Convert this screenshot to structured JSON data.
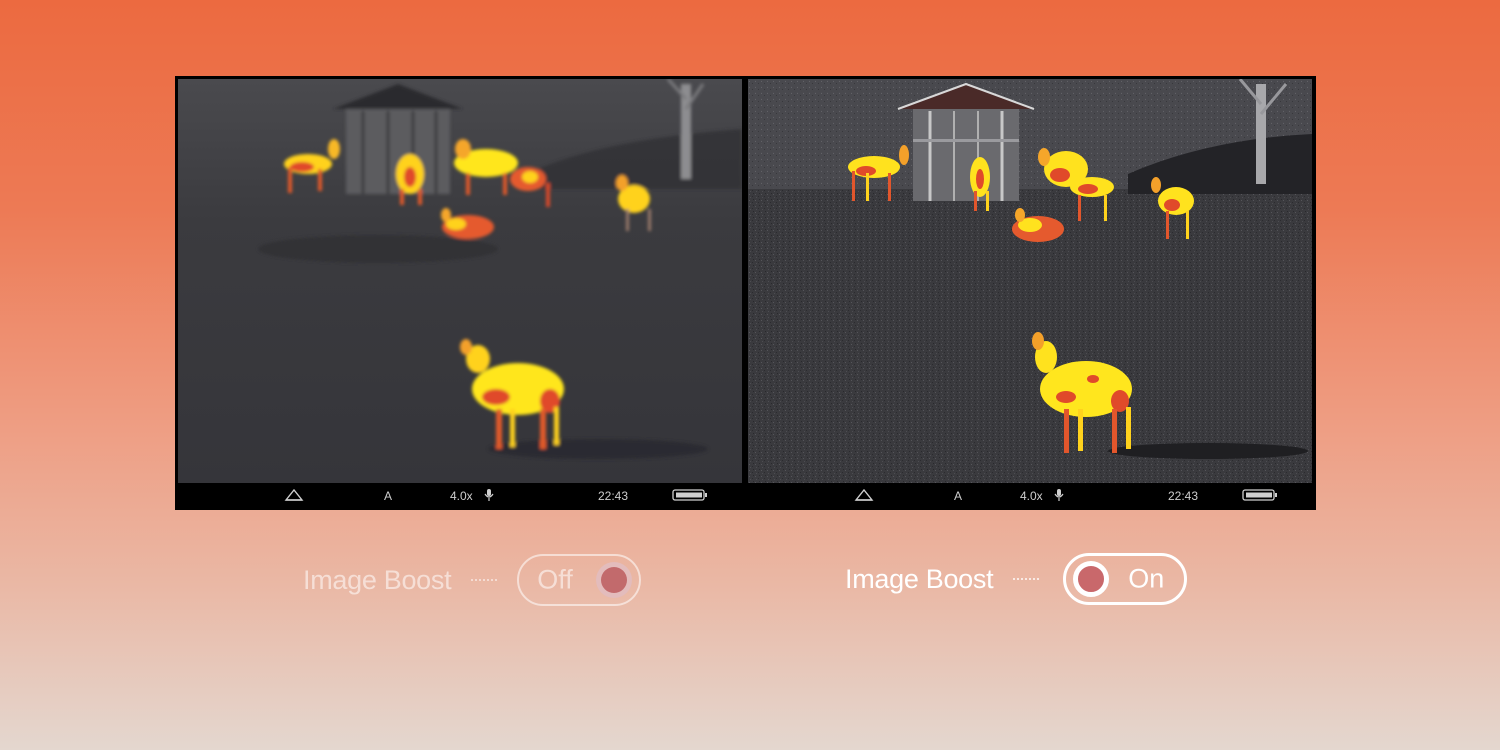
{
  "comparison": {
    "left_panel": {
      "mode": "A",
      "zoom": "4.0x",
      "time": "22:43",
      "icons": [
        "mountain-icon",
        "microphone-icon",
        "battery-icon"
      ]
    },
    "right_panel": {
      "mode": "A",
      "zoom": "4.0x",
      "time": "22:43",
      "icons": [
        "mountain-icon",
        "microphone-icon",
        "battery-icon"
      ]
    }
  },
  "toggles": [
    {
      "label": "Image Boost",
      "state": "Off",
      "active": false
    },
    {
      "label": "Image Boost",
      "state": "On",
      "active": true
    }
  ],
  "colors": {
    "background_top": "#ec6a40",
    "background_bottom": "#e4d7cf",
    "thermal_hot": "#ffe81f",
    "thermal_warm": "#e0452a",
    "frame": "#000000"
  }
}
